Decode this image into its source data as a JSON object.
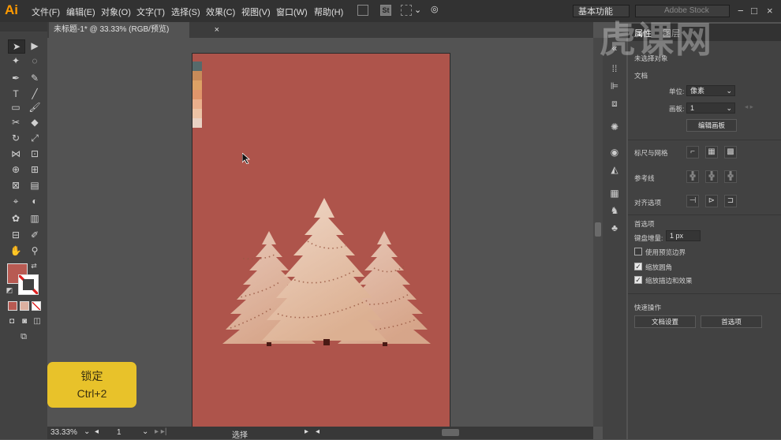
{
  "app": {
    "logo": "Ai"
  },
  "menu": [
    "文件(F)",
    "编辑(E)",
    "对象(O)",
    "文字(T)",
    "选择(S)",
    "效果(C)",
    "视图(V)",
    "窗口(W)",
    "帮助(H)"
  ],
  "menubar_extras": {
    "st_label": "St",
    "workspace": "基本功能",
    "search_placeholder": "Adobe Stock"
  },
  "watermark": "虎课网",
  "document_tab": {
    "title": "未标题-1* @ 33.33% (RGB/预览)",
    "close": "×"
  },
  "swatches": [
    "#566a6b",
    "#c78b59",
    "#dda265",
    "#e0956b",
    "#eaaf8c",
    "#ecc3a5",
    "#e9d2c4"
  ],
  "tooltip": {
    "title": "锁定",
    "shortcut": "Ctrl+2"
  },
  "status": {
    "zoom": "33.33%",
    "artboard": "1",
    "tool": "选择"
  },
  "panel": {
    "tabs": [
      "属性",
      "图层"
    ],
    "no_selection": "未选择对象",
    "document_section": "文档",
    "units_label": "单位:",
    "units_value": "像素",
    "artboard_label": "画板:",
    "artboard_value": "1",
    "edit_artboard_button": "编辑画板",
    "rulers_label": "标尺与网格",
    "guides_label": "参考线",
    "snap_label": "对齐选项",
    "prefs_section": "首选项",
    "keyboard_increment_label": "键盘增量:",
    "keyboard_increment_value": "1 px",
    "preview_bounds": "使用预览边界",
    "scale_corners": "缩放圆角",
    "scale_strokes": "缩放描边和效果",
    "quick_actions": "快速操作",
    "doc_setup_button": "文档设置",
    "preferences_button": "首选项"
  },
  "colors": {
    "artboard": "#ae544b",
    "fill": "#b85a52",
    "accent": "#ff9a00",
    "tooltip": "#e8c22a"
  }
}
